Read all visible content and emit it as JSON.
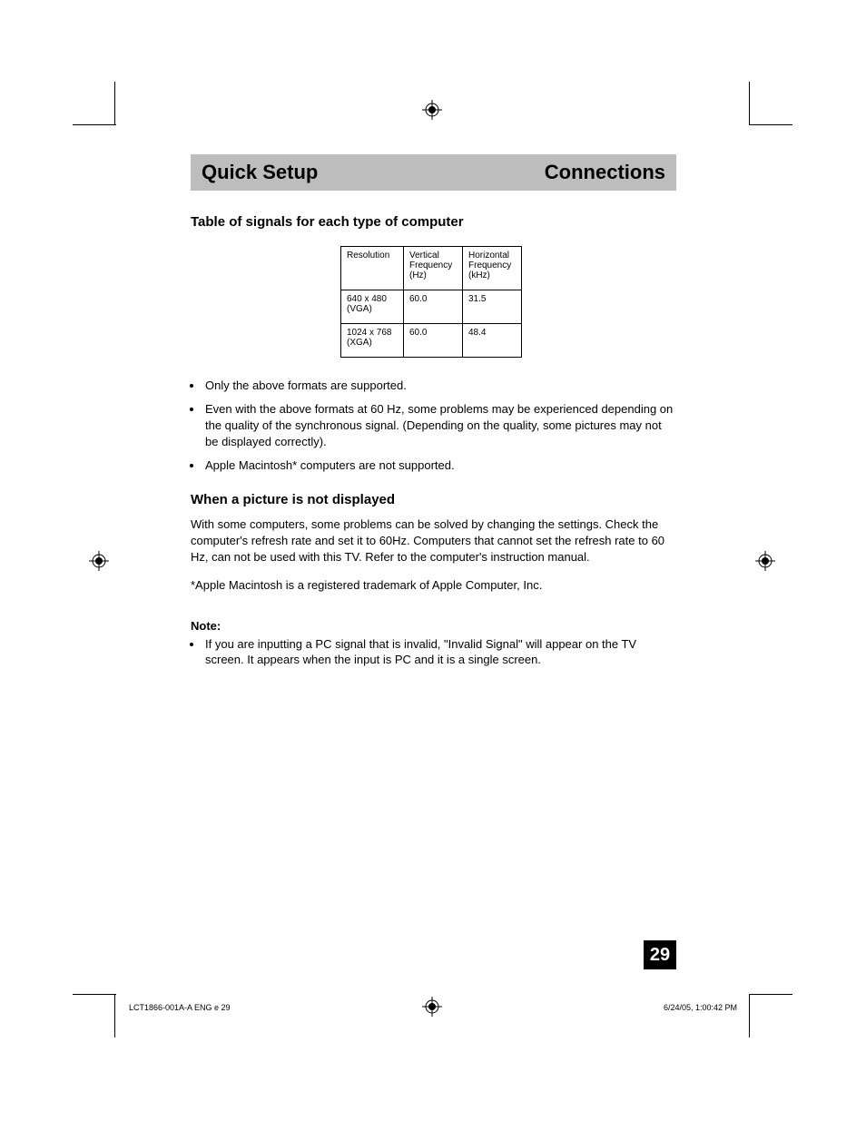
{
  "header": {
    "left": "Quick Setup",
    "right": "Connections"
  },
  "section1": {
    "heading": "Table of signals for each type of computer",
    "table": {
      "headers": [
        "Resolution",
        "Vertical Frequency (Hz)",
        "Horizontal Frequency (kHz)"
      ],
      "rows": [
        [
          "640 x 480 (VGA)",
          "60.0",
          "31.5"
        ],
        [
          "1024 x 768 (XGA)",
          "60.0",
          "48.4"
        ]
      ]
    },
    "bullets": [
      "Only the above formats are supported.",
      "Even with the above formats at 60 Hz, some problems may be experienced depending on the quality of the synchronous signal.  (Depending on the quality, some pictures may not be displayed correctly).",
      "Apple Macintosh* computers are not supported."
    ]
  },
  "section2": {
    "heading": "When a picture is not displayed",
    "body": "With some computers, some problems can be solved by changing the settings.  Check the computer's refresh rate and set it to 60Hz.  Computers that cannot set the refresh rate to 60 Hz, can not be used with this TV.  Refer to the computer's instruction manual.",
    "trademark": "*Apple Macintosh is a registered trademark of Apple Computer, Inc."
  },
  "note": {
    "label": "Note:",
    "items": [
      "If you are inputting a PC signal that is invalid, \"Invalid Signal\" will appear on the TV screen. It appears when the input is PC and it is a single screen."
    ]
  },
  "page_number": "29",
  "footer": {
    "left": "LCT1866-001A-A ENG e   29",
    "right": "6/24/05, 1:00:42 PM"
  }
}
